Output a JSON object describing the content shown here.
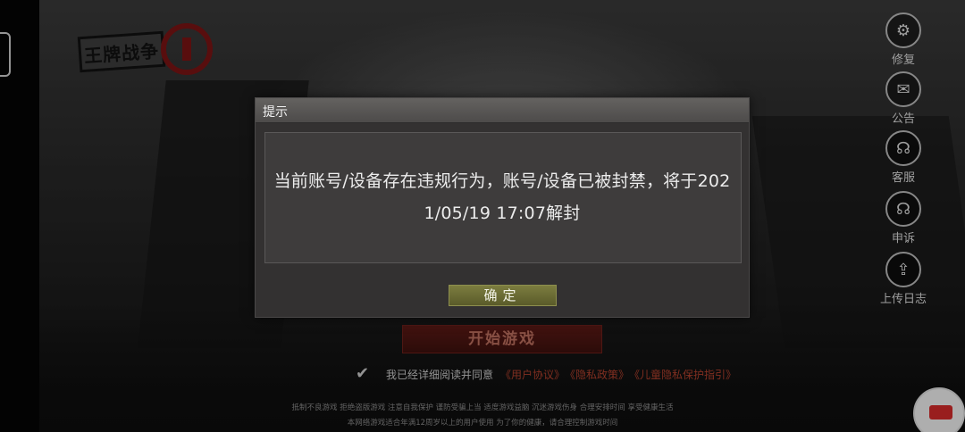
{
  "logo": {
    "text": "王牌战争"
  },
  "side_buttons": [
    {
      "label": "修复",
      "icon": "gear-icon",
      "glyph": "⚙"
    },
    {
      "label": "公告",
      "icon": "notice-icon",
      "glyph": "✉"
    },
    {
      "label": "客服",
      "icon": "headset-icon",
      "glyph": "☊"
    },
    {
      "label": "申诉",
      "icon": "appeal-headset-icon",
      "glyph": "☊"
    },
    {
      "label": "上传日志",
      "icon": "upload-icon",
      "glyph": "⇪"
    }
  ],
  "start_button": {
    "label": "开始游戏"
  },
  "agreement": {
    "prefix": "我已经详细阅读并同意",
    "links": [
      "《用户协议》",
      "《隐私政策》",
      "《儿童隐私保护指引》"
    ]
  },
  "footer": {
    "line1": "抵制不良游戏 拒绝盗版游戏 注意自我保护 谨防受骗上当 适度游戏益脑 沉迷游戏伤身 合理安排时间 享受健康生活",
    "line2": "本网络游戏适合年满12周岁以上的用户使用   为了你的健康，请合理控制游戏时间"
  },
  "dialog": {
    "title": "提示",
    "message": "当前账号/设备存在违规行为，账号/设备已被封禁，将于2021/05/19 17:07解封",
    "ok_label": "确定"
  },
  "colors": {
    "dialog_bg": "#333131",
    "ok_button": "#6b6c34",
    "start_button": "#4d1612",
    "link": "#b2412d"
  }
}
